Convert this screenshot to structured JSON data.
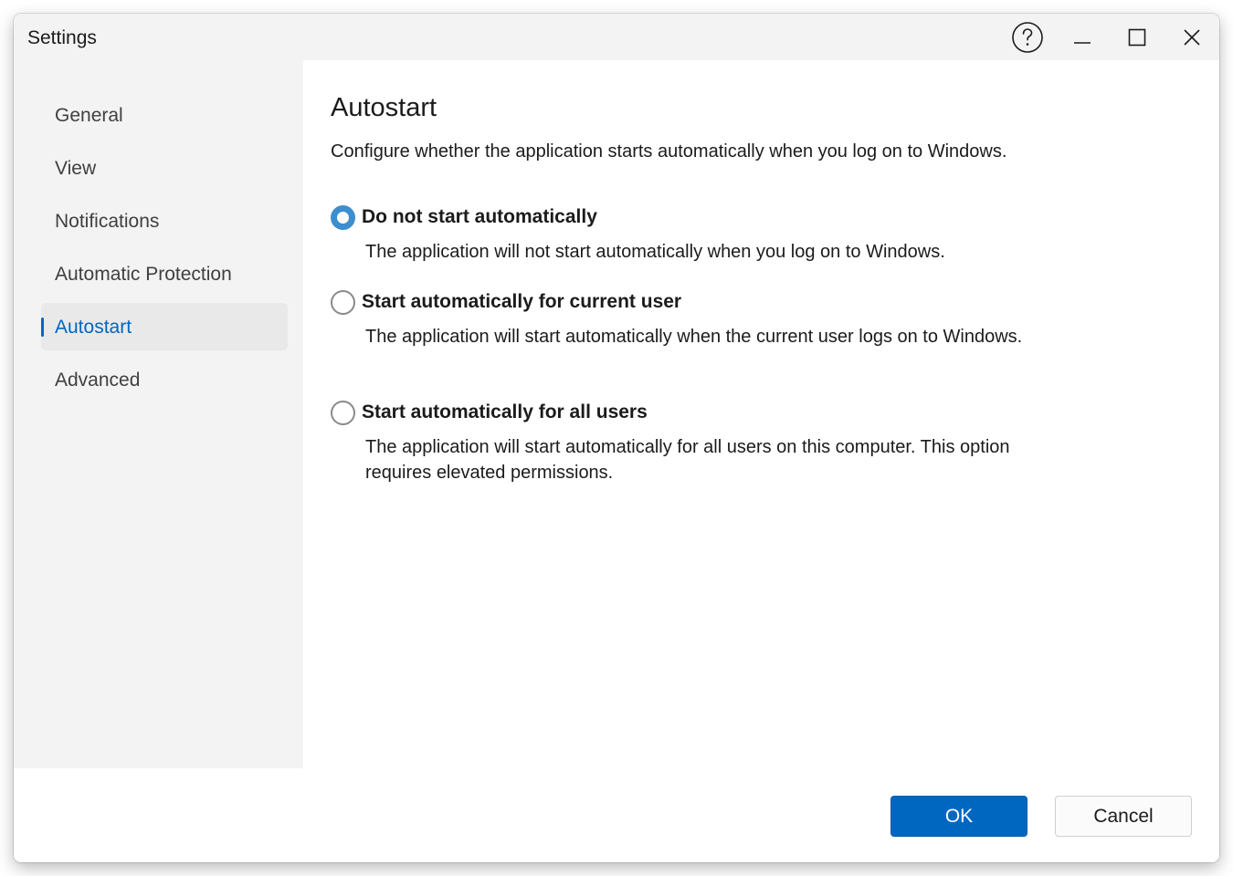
{
  "window": {
    "title": "Settings"
  },
  "titlebar": {
    "buttons": [
      {
        "name": "help",
        "icon": "help-circle-icon"
      },
      {
        "name": "minimize",
        "icon": "minimize-icon"
      },
      {
        "name": "maximize",
        "icon": "maximize-icon"
      },
      {
        "name": "close",
        "icon": "close-icon"
      }
    ]
  },
  "sidebar": {
    "items": [
      {
        "label": "General",
        "selected": false
      },
      {
        "label": "View",
        "selected": false
      },
      {
        "label": "Notifications",
        "selected": false
      },
      {
        "label": "Automatic Protection",
        "selected": false
      },
      {
        "label": "Autostart",
        "selected": true
      },
      {
        "label": "Advanced",
        "selected": false
      }
    ]
  },
  "main": {
    "title": "Autostart",
    "description": "Configure whether the application starts automatically when you log on to Windows.",
    "options": [
      {
        "label": "Do not start automatically",
        "description": "The application will not start automatically when you log on to Windows.",
        "checked": true
      },
      {
        "label": "Start automatically for current user",
        "description": "The application will start automatically when the current user logs on to Windows.",
        "checked": false
      },
      {
        "label": "Start automatically for all users",
        "description": "The application will start automatically for all users on this computer. This option requires elevated permissions.",
        "checked": false
      }
    ]
  },
  "footer": {
    "ok_label": "OK",
    "cancel_label": "Cancel"
  },
  "colors": {
    "accent": "#0067c0",
    "radio_checked": "#3c8ecf",
    "sidebar_bg": "#f3f3f3",
    "selected_item_bg": "#e9e9e9"
  }
}
